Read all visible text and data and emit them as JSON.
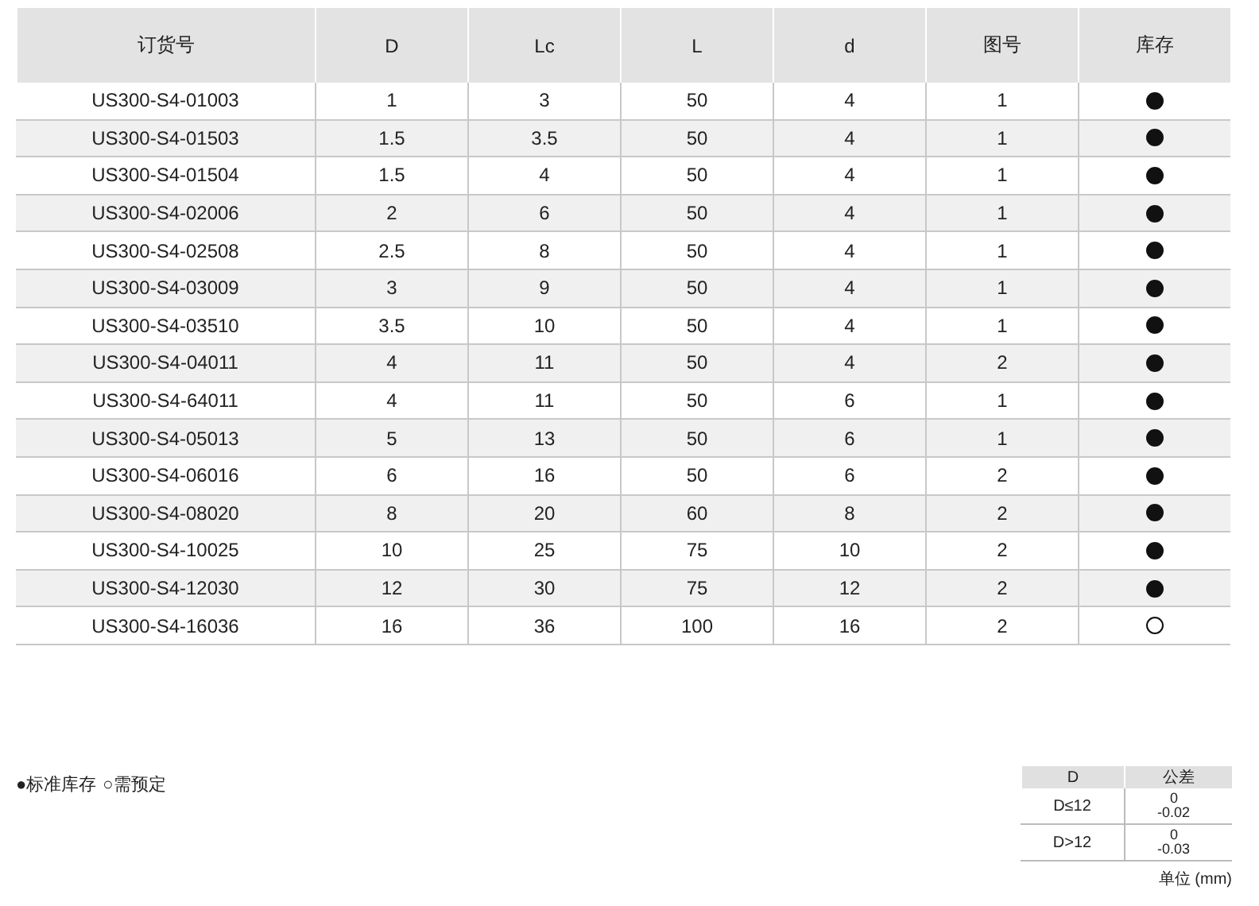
{
  "table": {
    "columns": [
      "订货号",
      "D",
      "Lc",
      "L",
      "d",
      "图号",
      "库存"
    ],
    "rows": [
      {
        "cells": [
          "US300-S4-01003",
          "1",
          "3",
          "50",
          "4",
          "1"
        ],
        "in_stock": true
      },
      {
        "cells": [
          "US300-S4-01503",
          "1.5",
          "3.5",
          "50",
          "4",
          "1"
        ],
        "in_stock": true
      },
      {
        "cells": [
          "US300-S4-01504",
          "1.5",
          "4",
          "50",
          "4",
          "1"
        ],
        "in_stock": true
      },
      {
        "cells": [
          "US300-S4-02006",
          "2",
          "6",
          "50",
          "4",
          "1"
        ],
        "in_stock": true
      },
      {
        "cells": [
          "US300-S4-02508",
          "2.5",
          "8",
          "50",
          "4",
          "1"
        ],
        "in_stock": true
      },
      {
        "cells": [
          "US300-S4-03009",
          "3",
          "9",
          "50",
          "4",
          "1"
        ],
        "in_stock": true
      },
      {
        "cells": [
          "US300-S4-03510",
          "3.5",
          "10",
          "50",
          "4",
          "1"
        ],
        "in_stock": true
      },
      {
        "cells": [
          "US300-S4-04011",
          "4",
          "11",
          "50",
          "4",
          "2"
        ],
        "in_stock": true
      },
      {
        "cells": [
          "US300-S4-64011",
          "4",
          "11",
          "50",
          "6",
          "1"
        ],
        "in_stock": true
      },
      {
        "cells": [
          "US300-S4-05013",
          "5",
          "13",
          "50",
          "6",
          "1"
        ],
        "in_stock": true
      },
      {
        "cells": [
          "US300-S4-06016",
          "6",
          "16",
          "50",
          "6",
          "2"
        ],
        "in_stock": true
      },
      {
        "cells": [
          "US300-S4-08020",
          "8",
          "20",
          "60",
          "8",
          "2"
        ],
        "in_stock": true
      },
      {
        "cells": [
          "US300-S4-10025",
          "10",
          "25",
          "75",
          "10",
          "2"
        ],
        "in_stock": true
      },
      {
        "cells": [
          "US300-S4-12030",
          "12",
          "30",
          "75",
          "12",
          "2"
        ],
        "in_stock": true
      },
      {
        "cells": [
          "US300-S4-16036",
          "16",
          "36",
          "100",
          "16",
          "2"
        ],
        "in_stock": false
      }
    ]
  },
  "legend": [
    "●标准库存",
    "○需预定"
  ],
  "tolerance_table": {
    "columns": [
      "D",
      "公差"
    ],
    "rows": [
      {
        "range": "D≤12",
        "upper": "0",
        "lower": "-0.02"
      },
      {
        "range": "D>12",
        "upper": "0",
        "lower": "-0.03"
      }
    ],
    "unit": "单位 (mm)"
  }
}
